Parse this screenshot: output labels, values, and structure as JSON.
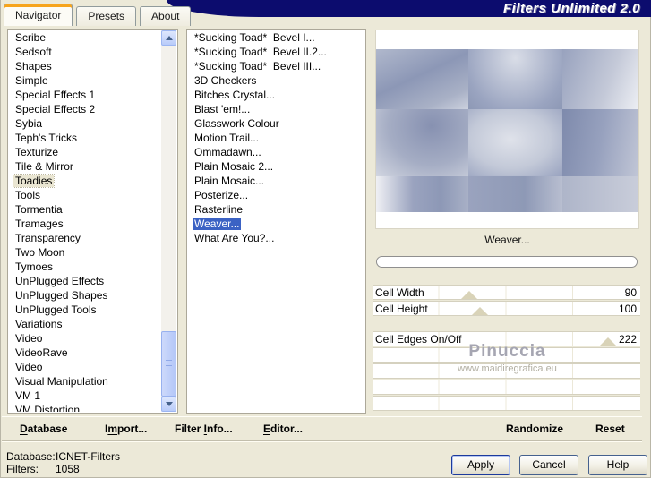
{
  "window": {
    "title": "Filters Unlimited 2.0",
    "tabs": [
      {
        "label": "Navigator",
        "active": true
      },
      {
        "label": "Presets",
        "active": false
      },
      {
        "label": "About",
        "active": false
      }
    ]
  },
  "categories": {
    "selected": "Toadies",
    "items": [
      "Scribe",
      "Sedsoft",
      "Shapes",
      "Simple",
      "Special Effects 1",
      "Special Effects 2",
      "Sybia",
      "Teph's Tricks",
      "Texturize",
      "Tile & Mirror",
      "Toadies",
      "Tools",
      "Tormentia",
      "Tramages",
      "Transparency",
      "Two Moon",
      "Tymoes",
      "UnPlugged Effects",
      "UnPlugged Shapes",
      "UnPlugged Tools",
      "Variations",
      "Video",
      "VideoRave",
      "Video",
      "Visual Manipulation",
      "VM 1",
      "VM Distortion"
    ]
  },
  "filters": {
    "selected": "Weaver...",
    "items": [
      "*Sucking Toad*  Bevel I...",
      "*Sucking Toad*  Bevel II.2...",
      "*Sucking Toad*  Bevel III...",
      "3D Checkers",
      "Bitches Crystal...",
      "Blast 'em!...",
      "Glasswork Colour",
      "Motion Trail...",
      "Ommadawn...",
      "Plain Mosaic 2...",
      "Plain Mosaic...",
      "Posterize...",
      "Rasterline",
      "Weaver...",
      "What Are You?..."
    ]
  },
  "preview": {
    "caption": "Weaver..."
  },
  "sliders": [
    {
      "label": "Cell Width",
      "value": "90",
      "pos": 36,
      "gap_before": false
    },
    {
      "label": "Cell Height",
      "value": "100",
      "pos": 40,
      "gap_before": false
    },
    {
      "label": "Cell Edges On/Off",
      "value": "222",
      "pos": 88,
      "gap_before": true
    }
  ],
  "watermark": {
    "line1": "Pinuccia",
    "line2": "www.maidiregrafica.eu"
  },
  "toolbar": {
    "items": [
      {
        "pre": "",
        "u": "D",
        "post": "atabase"
      },
      {
        "pre": "I",
        "u": "m",
        "post": "port..."
      },
      {
        "pre": "Filter ",
        "u": "I",
        "post": "nfo..."
      },
      {
        "pre": "",
        "u": "E",
        "post": "ditor..."
      }
    ],
    "randomize": "Randomize",
    "reset": "Reset"
  },
  "status": {
    "database_label": "Database:",
    "database_value": "ICNET-Filters",
    "filters_label": "Filters:",
    "filters_value": "1058"
  },
  "buttons": {
    "apply": "Apply",
    "cancel": "Cancel",
    "help": "Help"
  },
  "colors": {
    "accent_navy": "#0c0c6e",
    "selection_blue": "#3b62c4",
    "tab_orange": "#f6a41c",
    "dialog_beige": "#ece9d8"
  }
}
